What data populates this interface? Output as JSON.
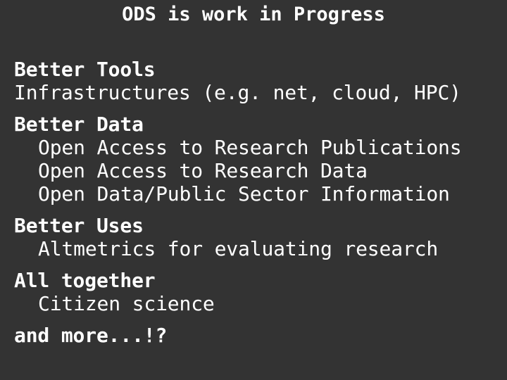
{
  "slide": {
    "title": "ODS is work in Progress",
    "background_color": "#333333",
    "text_color": "#ffffff",
    "sections": [
      {
        "heading": "Better Tools",
        "items": [
          {
            "text": "Infrastructures (e.g. net, cloud, HPC)",
            "indented": false
          }
        ]
      },
      {
        "heading": "Better Data",
        "items": [
          {
            "text": "Open Access to Research Publications",
            "indented": true
          },
          {
            "text": "Open Access to Research Data",
            "indented": true
          },
          {
            "text": "Open Data/Public Sector Information",
            "indented": true
          }
        ]
      },
      {
        "heading": "Better Uses",
        "items": [
          {
            "text": "Altmetrics for evaluating research",
            "indented": true
          }
        ]
      },
      {
        "heading": "All together",
        "items": [
          {
            "text": "Citizen science",
            "indented": true
          }
        ]
      }
    ],
    "closing": "and more...!?"
  }
}
